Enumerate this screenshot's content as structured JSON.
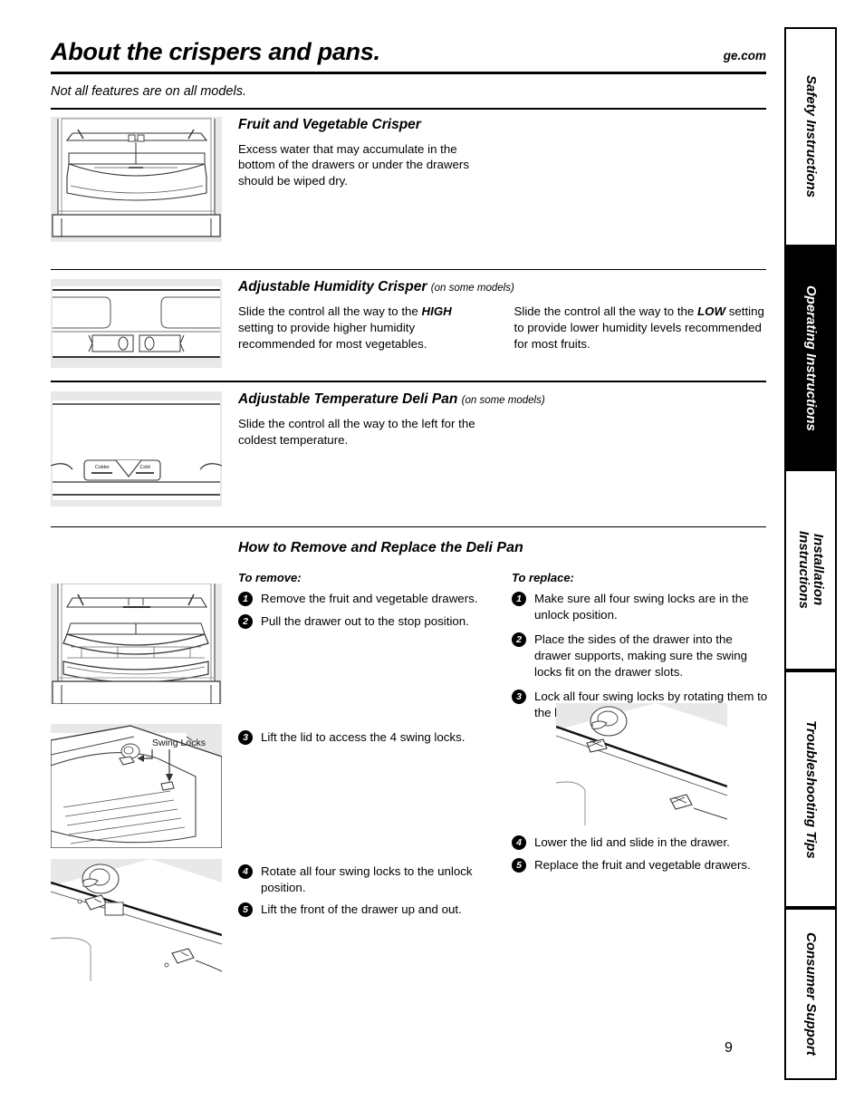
{
  "header": {
    "title": "About the crispers and pans.",
    "site": "ge.com",
    "note": "Not all features are on all models."
  },
  "sections": {
    "crisper": {
      "heading": "Fruit and Vegetable Crisper",
      "body": "Excess water that may accumulate in the bottom of the drawers or under the drawers should be wiped dry."
    },
    "humidity": {
      "heading": "Adjustable Humidity Crisper",
      "qualifier": "(on some models)",
      "left_pre": "Slide the control all the way to the ",
      "left_bold": "HIGH",
      "left_post": " setting to provide higher humidity recommended for most vegetables.",
      "right_pre": "Slide the control all the way to the ",
      "right_bold": "LOW",
      "right_post": " setting to provide lower humidity levels recommended for most fruits."
    },
    "deli": {
      "heading": "Adjustable Temperature Deli Pan",
      "qualifier": "(on some models)",
      "body": "Slide the control all the way to the left for the coldest temperature.",
      "control_left_label": "Colder",
      "control_right_label": "Cold"
    },
    "remove_replace": {
      "heading": "How to Remove and Replace the Deli Pan",
      "remove_label": "To remove:",
      "replace_label": "To replace:",
      "remove_steps": [
        {
          "n": "1",
          "text": "Remove the fruit and vegetable drawers."
        },
        {
          "n": "2",
          "text": "Pull the drawer out to the stop position."
        },
        {
          "n": "3",
          "text": "Lift the lid to access the 4 swing locks."
        },
        {
          "n": "4",
          "text": "Rotate all four swing locks to the unlock position."
        },
        {
          "n": "5",
          "text": "Lift the front of the drawer up and out."
        }
      ],
      "replace_steps": [
        {
          "n": "1",
          "text": "Make sure all four swing locks are in the unlock position."
        },
        {
          "n": "2",
          "text": "Place the sides of the drawer into the drawer supports, making sure the swing locks fit on the drawer slots."
        },
        {
          "n": "3",
          "text": "Lock all four swing locks by rotating them to the lock position."
        },
        {
          "n": "4",
          "text": "Lower the lid and slide in the drawer."
        },
        {
          "n": "5",
          "text": "Replace the fruit and vegetable drawers."
        }
      ],
      "swing_locks_label": "Swing Locks"
    }
  },
  "sidebar": {
    "tabs": [
      {
        "label": "Safety Instructions",
        "active": false
      },
      {
        "label": "Operating Instructions",
        "active": true
      },
      {
        "label": "Installation\nInstructions",
        "active": false
      },
      {
        "label": "Troubleshooting Tips",
        "active": false
      },
      {
        "label": "Consumer Support",
        "active": false
      }
    ]
  },
  "footer": {
    "page_number": "9"
  }
}
